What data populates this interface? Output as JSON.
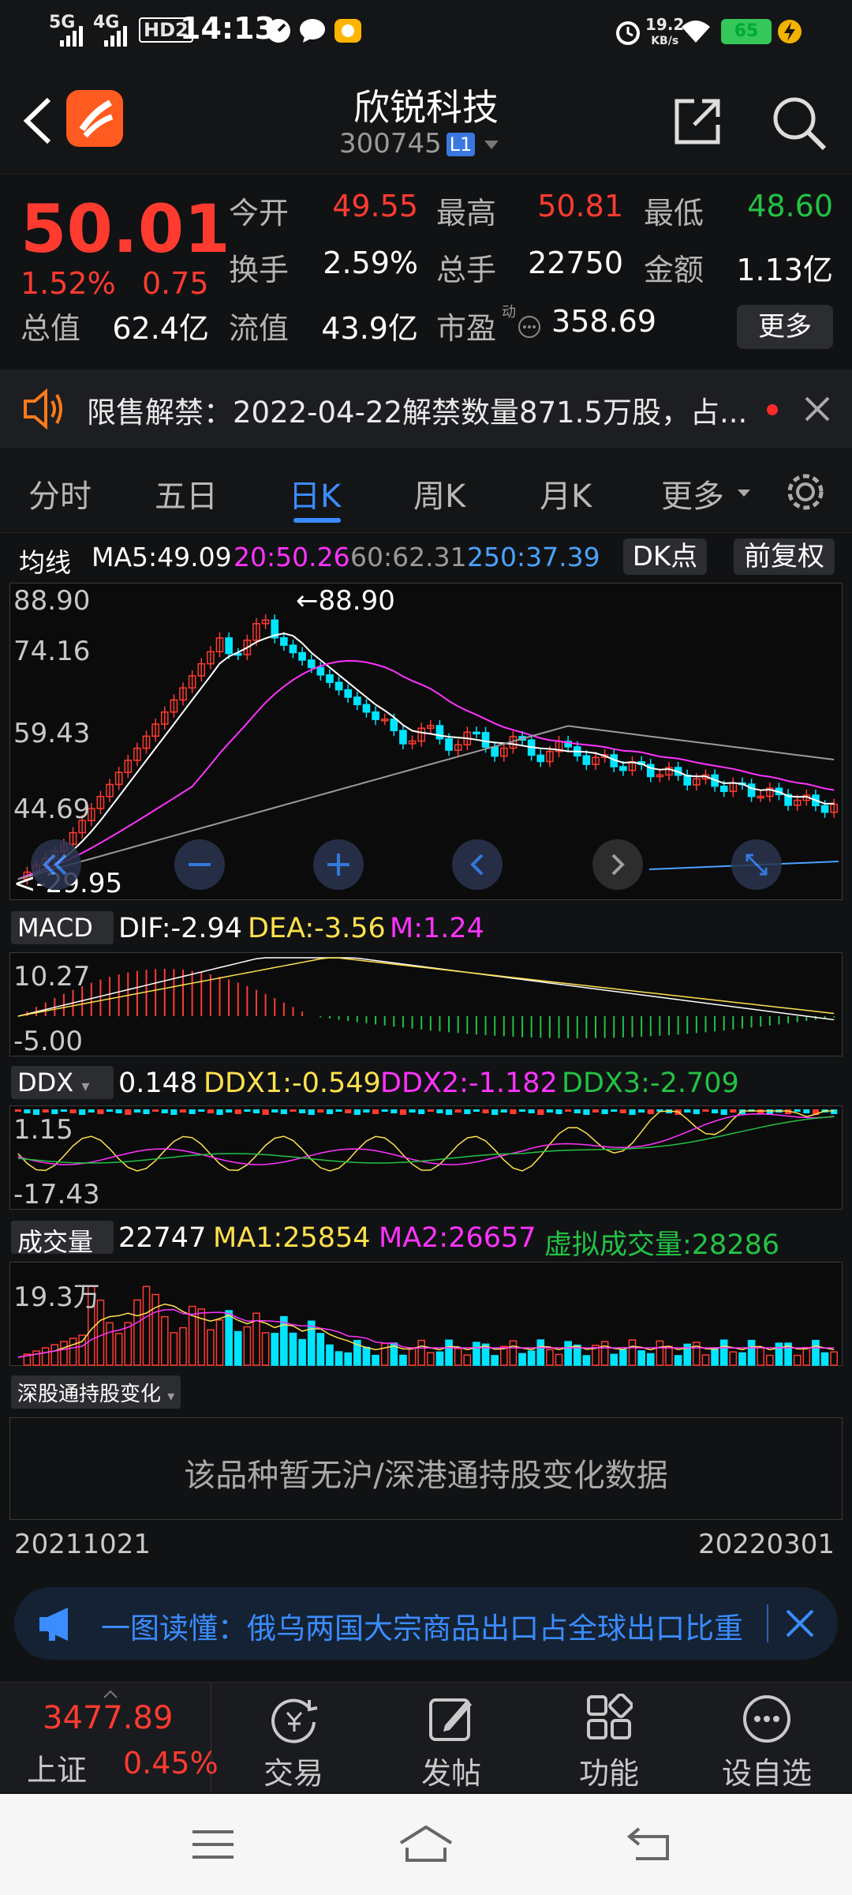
{
  "status": {
    "time": "14:13",
    "network_left": "5G",
    "network_right": "4G",
    "hd": "HD2",
    "speed": "19.2",
    "speed_unit": "KB/s",
    "battery": "65"
  },
  "header": {
    "name": "欣锐科技",
    "code": "300745",
    "level": "L1"
  },
  "quote": {
    "price": "50.01",
    "pct": "1.52%",
    "chg": "0.75",
    "open_label": "今开",
    "open": "49.55",
    "high_label": "最高",
    "high": "50.81",
    "low_label": "最低",
    "low": "48.60",
    "turnover_label": "换手",
    "turnover": "2.59%",
    "volume_label": "总手",
    "volume": "22750",
    "amount_label": "金额",
    "amount": "1.13亿",
    "mcap_label": "总值",
    "mcap": "62.4亿",
    "float_label": "流值",
    "float": "43.9亿",
    "pe_label": "市盈",
    "pe_sup": "动",
    "pe": "358.69",
    "more": "更多"
  },
  "notice": {
    "text": "限售解禁：2022-04-22解禁数量871.5万股，占..."
  },
  "tabs": [
    "分时",
    "五日",
    "日K",
    "周K",
    "月K",
    "更多"
  ],
  "ma": {
    "title": "均线",
    "ma5": "MA5:49.09",
    "ma20": "20:50.26",
    "ma60": "60:62.31",
    "ma250": "250:37.39",
    "dk": "DK点",
    "fq": "前复权"
  },
  "kline": {
    "y_labels": [
      "88.90",
      "74.16",
      "59.43",
      "44.69"
    ],
    "max_label": "88.90",
    "min_label": "29.95"
  },
  "macd": {
    "selector": "MACD",
    "dif": "DIF:-2.94",
    "dea": "DEA:-3.56",
    "m": "M:1.24",
    "y_top": "10.27",
    "y_bottom": "-5.00"
  },
  "ddx": {
    "selector": "DDX",
    "v": "0.148",
    "ddx1": "DDX1:-0.549",
    "ddx2": "DDX2:-1.182",
    "ddx3": "DDX3:-2.709",
    "y_top": "1.15",
    "y_bottom": "-17.43"
  },
  "vol": {
    "selector": "成交量",
    "v": "22747",
    "ma1": "MA1:25854",
    "ma2": "MA2:26657",
    "virtual": "虚拟成交量:28286",
    "y_top": "19.3万"
  },
  "hk": {
    "selector": "深股通持股变化",
    "message": "该品种暂无沪/深港通持股变化数据"
  },
  "dates": {
    "start": "20211021",
    "end": "20220301"
  },
  "banner": {
    "text": "一图读懂：俄乌两国大宗商品出口占全球出口比重"
  },
  "bottom": {
    "index_value": "3477.89",
    "index_name": "上证",
    "index_pct": "0.45%",
    "trade": "交易",
    "post": "发帖",
    "func": "功能",
    "watch": "设自选"
  },
  "colors": {
    "up": "#ff3b30",
    "down": "#00e5ff",
    "ma5": "#ffffff",
    "ma20": "#ff33ff",
    "ma60": "#9a9a9a",
    "ma250": "#4aa3ff"
  }
}
